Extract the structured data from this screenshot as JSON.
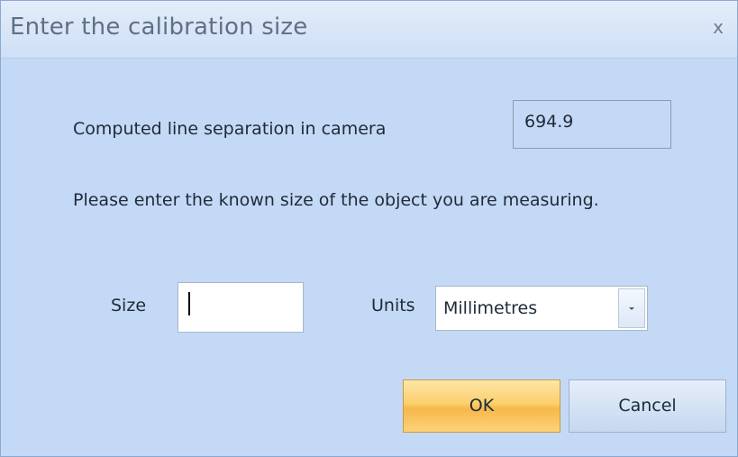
{
  "window": {
    "title": "Enter the calibration size",
    "close_glyph": "x"
  },
  "computed": {
    "label": "Computed line separation in camera",
    "value": "694.9"
  },
  "prompt": "Please enter the known size of the object you are measuring.",
  "size": {
    "label": "Size",
    "value": ""
  },
  "units": {
    "label": "Units",
    "selected": "Millimetres"
  },
  "buttons": {
    "ok": "OK",
    "cancel": "Cancel"
  },
  "colors": {
    "dialog_background": "#c4d9f5",
    "ok_button": "#fbcf6c",
    "cancel_button": "#d5e3f4"
  }
}
